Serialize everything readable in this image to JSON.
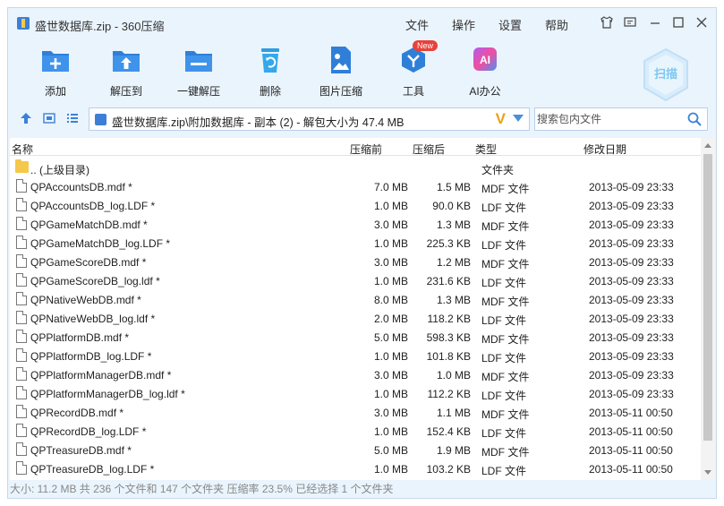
{
  "window": {
    "title": "盛世数据库.zip - 360压缩",
    "menus": [
      "文件",
      "操作",
      "设置",
      "帮助"
    ]
  },
  "toolbar": {
    "add": "添加",
    "extract_to": "解压到",
    "one_click": "一键解压",
    "delete": "删除",
    "image_compress": "图片压缩",
    "tools": "工具",
    "tools_badge": "New",
    "ai_office": "AI办公",
    "ai_glyph": "AI",
    "scan": "扫描"
  },
  "address": {
    "path": "盛世数据库.zip\\附加数据库 - 副本 (2) - 解包大小为 47.4 MB",
    "v_mark": "V"
  },
  "search": {
    "placeholder": "搜索包内文件"
  },
  "columns": {
    "name": "名称",
    "before": "压缩前",
    "after": "压缩后",
    "type": "类型",
    "date": "修改日期"
  },
  "parent_row": {
    "name": ".. (上级目录)",
    "type": "文件夹"
  },
  "files": [
    {
      "name": "QPAccountsDB.mdf *",
      "before": "7.0 MB",
      "after": "1.5 MB",
      "type": "MDF 文件",
      "date": "2013-05-09 23:33"
    },
    {
      "name": "QPAccountsDB_log.LDF *",
      "before": "1.0 MB",
      "after": "90.0 KB",
      "type": "LDF 文件",
      "date": "2013-05-09 23:33"
    },
    {
      "name": "QPGameMatchDB.mdf *",
      "before": "3.0 MB",
      "after": "1.3 MB",
      "type": "MDF 文件",
      "date": "2013-05-09 23:33"
    },
    {
      "name": "QPGameMatchDB_log.LDF *",
      "before": "1.0 MB",
      "after": "225.3 KB",
      "type": "LDF 文件",
      "date": "2013-05-09 23:33"
    },
    {
      "name": "QPGameScoreDB.mdf *",
      "before": "3.0 MB",
      "after": "1.2 MB",
      "type": "MDF 文件",
      "date": "2013-05-09 23:33"
    },
    {
      "name": "QPGameScoreDB_log.ldf *",
      "before": "1.0 MB",
      "after": "231.6 KB",
      "type": "LDF 文件",
      "date": "2013-05-09 23:33"
    },
    {
      "name": "QPNativeWebDB.mdf *",
      "before": "8.0 MB",
      "after": "1.3 MB",
      "type": "MDF 文件",
      "date": "2013-05-09 23:33"
    },
    {
      "name": "QPNativeWebDB_log.ldf *",
      "before": "2.0 MB",
      "after": "118.2 KB",
      "type": "LDF 文件",
      "date": "2013-05-09 23:33"
    },
    {
      "name": "QPPlatformDB.mdf *",
      "before": "5.0 MB",
      "after": "598.3 KB",
      "type": "MDF 文件",
      "date": "2013-05-09 23:33"
    },
    {
      "name": "QPPlatformDB_log.LDF *",
      "before": "1.0 MB",
      "after": "101.8 KB",
      "type": "LDF 文件",
      "date": "2013-05-09 23:33"
    },
    {
      "name": "QPPlatformManagerDB.mdf *",
      "before": "3.0 MB",
      "after": "1.0 MB",
      "type": "MDF 文件",
      "date": "2013-05-09 23:33"
    },
    {
      "name": "QPPlatformManagerDB_log.ldf *",
      "before": "1.0 MB",
      "after": "112.2 KB",
      "type": "LDF 文件",
      "date": "2013-05-09 23:33"
    },
    {
      "name": "QPRecordDB.mdf *",
      "before": "3.0 MB",
      "after": "1.1 MB",
      "type": "MDF 文件",
      "date": "2013-05-11 00:50"
    },
    {
      "name": "QPRecordDB_log.LDF *",
      "before": "1.0 MB",
      "after": "152.4 KB",
      "type": "LDF 文件",
      "date": "2013-05-11 00:50"
    },
    {
      "name": "QPTreasureDB.mdf *",
      "before": "5.0 MB",
      "after": "1.9 MB",
      "type": "MDF 文件",
      "date": "2013-05-11 00:50"
    },
    {
      "name": "QPTreasureDB_log.LDF *",
      "before": "1.0 MB",
      "after": "103.2 KB",
      "type": "LDF 文件",
      "date": "2013-05-11 00:50"
    }
  ],
  "status": "大小: 11.2 MB 共 236 个文件和 147 个文件夹 压缩率 23.5% 已经选择 1 个文件夹",
  "colors": {
    "accent": "#3b82d6",
    "window_bg": "#eaf4fd",
    "folder": "#f4c84a"
  },
  "icons": [
    "add-icon",
    "extract-icon",
    "one-click-extract-icon",
    "delete-icon",
    "image-compress-icon",
    "tools-icon",
    "ai-icon",
    "scan-icon",
    "up-arrow-icon",
    "view-thumbnail-icon",
    "view-list-icon",
    "search-icon",
    "folder-icon",
    "file-icon"
  ]
}
